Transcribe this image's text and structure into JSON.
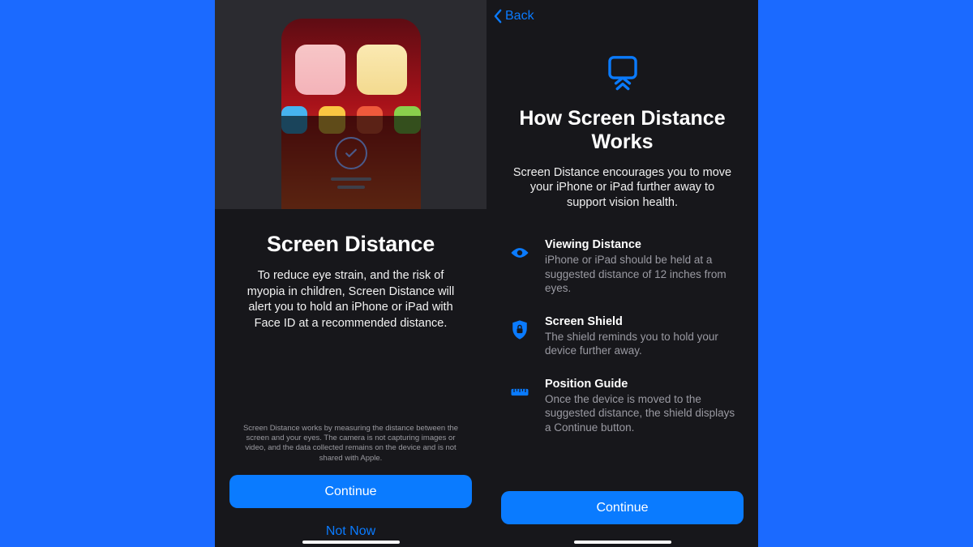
{
  "colors": {
    "page_bg": "#1b6aff",
    "phone_bg": "#17171b",
    "accent": "#0a7bff"
  },
  "left": {
    "title": "Screen Distance",
    "description": "To reduce eye strain, and the risk of myopia in children, Screen Distance will alert you to hold an iPhone or iPad with Face ID at a recommended distance.",
    "fine_print": "Screen Distance works by measuring the distance between the screen and your eyes. The camera is not capturing images or video, and the data collected remains on the device and is not shared with Apple.",
    "primary_button": "Continue",
    "secondary_button": "Not Now"
  },
  "right": {
    "back_label": "Back",
    "title": "How Screen Distance Works",
    "description": "Screen Distance encourages you to move your iPhone or iPad further away to support vision health.",
    "features": [
      {
        "icon": "eye-icon",
        "title": "Viewing Distance",
        "body": "iPhone or iPad should be held at a suggested distance of 12 inches from eyes."
      },
      {
        "icon": "shield-lock-icon",
        "title": "Screen Shield",
        "body": "The shield reminds you to hold your device further away."
      },
      {
        "icon": "ruler-icon",
        "title": "Position Guide",
        "body": "Once the device is moved to the suggested distance, the shield displays a Continue button."
      }
    ],
    "primary_button": "Continue"
  }
}
